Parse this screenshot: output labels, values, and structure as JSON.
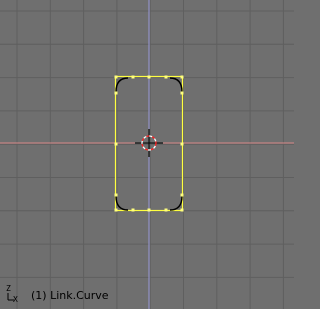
{
  "viewport": {
    "background": "#6f6f6f",
    "grid_color": "#5f5f5f",
    "x_axis_color": "#d98a8a",
    "y_axis_color": "#9a9ad8",
    "curve_select_color": "#ffff40",
    "curve_handle_color": "#000000",
    "vertex_color": "#ffff80",
    "cursor_ring_colors": [
      "#ff2020",
      "#ffffff"
    ],
    "object_label": "(1) Link.Curve",
    "axis_gizmo": {
      "z_label": "Z",
      "x_label": "X"
    }
  }
}
